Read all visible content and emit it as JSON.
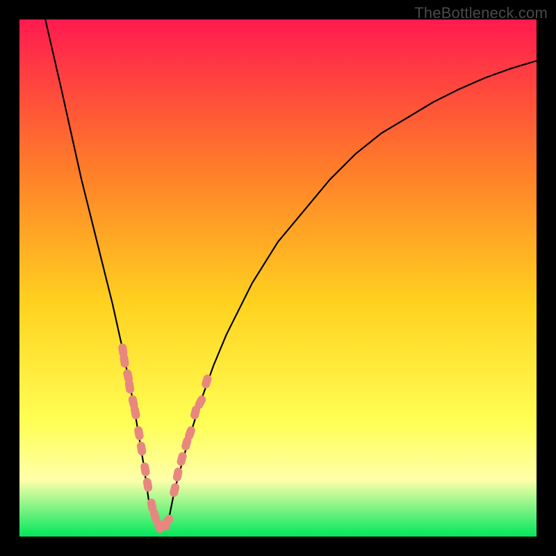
{
  "watermark": "TheBottleneck.com",
  "colors": {
    "frame": "#000000",
    "gradient_top": "#ff1a4f",
    "gradient_mid1": "#ff7a2a",
    "gradient_mid2": "#ffd21f",
    "gradient_mid3": "#ffff55",
    "gradient_band": "#ffffaa",
    "gradient_bottom": "#00e85c",
    "curve": "#000000",
    "dots": "#e8877f"
  },
  "chart_data": {
    "type": "line",
    "title": "",
    "xlabel": "",
    "ylabel": "",
    "xlim": [
      0,
      100
    ],
    "ylim": [
      0,
      100
    ],
    "series": [
      {
        "name": "curve",
        "x": [
          5,
          8,
          10,
          12,
          14,
          16,
          18,
          20,
          21,
          22,
          23,
          24,
          25,
          26,
          27,
          28,
          29,
          30,
          32.5,
          35,
          37.5,
          40,
          45,
          50,
          55,
          60,
          65,
          70,
          75,
          80,
          85,
          90,
          95,
          100
        ],
        "y": [
          100,
          87,
          78,
          69,
          61,
          53,
          45,
          36,
          31,
          26,
          20,
          14,
          7,
          3,
          2,
          2,
          4,
          9,
          18,
          26,
          33,
          39,
          49,
          57,
          63,
          69,
          74,
          78,
          81,
          84,
          86.5,
          88.7,
          90.5,
          92
        ]
      }
    ],
    "highlight_points": {
      "name": "dots",
      "x": [
        20.0,
        20.3,
        21.0,
        21.3,
        22.0,
        22.4,
        23.1,
        23.6,
        24.3,
        24.8,
        25.6,
        26.2,
        27.0,
        27.8,
        28.6,
        30.0,
        30.6,
        31.4,
        32.3,
        33.0,
        34.0,
        35.0,
        36.2
      ],
      "y": [
        36,
        34,
        31,
        29,
        26,
        24,
        20,
        17,
        13,
        10,
        6,
        4,
        2,
        2,
        3,
        9,
        12,
        15,
        18,
        20,
        24,
        26,
        30
      ]
    }
  }
}
